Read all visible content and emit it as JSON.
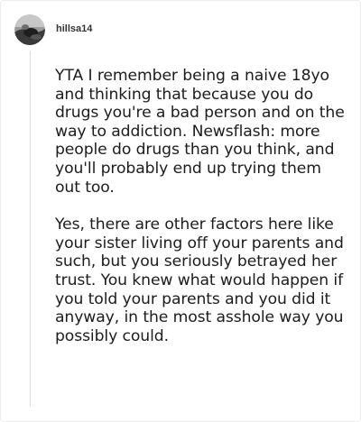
{
  "comment": {
    "author": "hillsa14",
    "avatar_icon": "user-avatar-icon",
    "paragraphs": [
      "YTA I remember being a naive 18yo and thinking that because you do drugs you're a bad person and on the way to addiction. Newsflash: more people do drugs than you think, and you'll probably end up trying them out too.",
      "Yes, there are other factors here like your sister living off your parents and such, but you seriously betrayed her trust. You knew what would happen if you told your parents and you did it anyway, in the most asshole way you possibly could."
    ]
  },
  "colors": {
    "text": "#1c1c1c",
    "username": "#333333",
    "thread_line": "#dcdcdc",
    "border": "#ececec"
  }
}
